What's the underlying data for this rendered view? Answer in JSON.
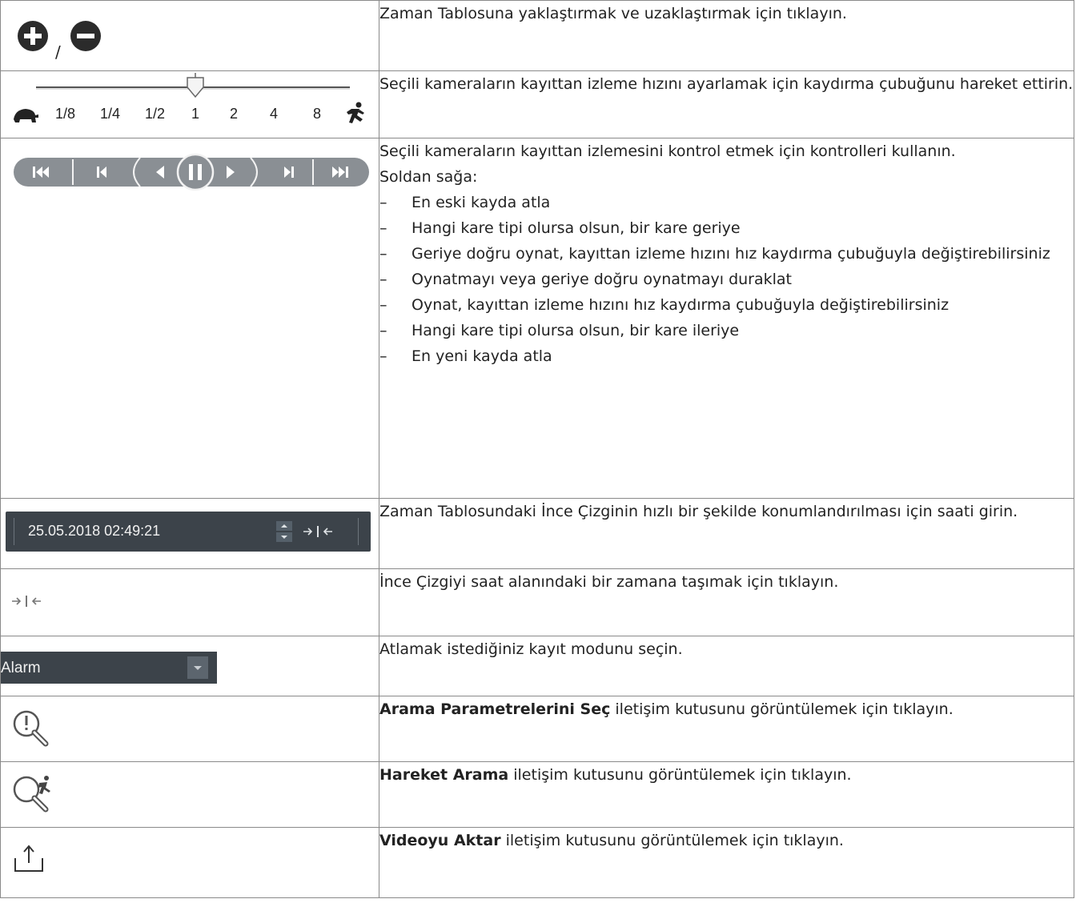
{
  "rows": [
    {
      "icon": "zoom-in-zoom-out-icons",
      "separator": "/",
      "text": "Zaman Tablosuna yaklaştırmak ve uzaklaştırmak için tıklayın."
    },
    {
      "icon": "speed-slider",
      "speed_labels": [
        "1/8",
        "1/4",
        "1/2",
        "1",
        "2",
        "4",
        "8"
      ],
      "speed_value": "1",
      "text": "Seçili kameraların kayıttan izleme hızını ayarlamak için kaydırma çubuğunu hareket ettirin."
    },
    {
      "icon": "playback-controls",
      "intro": "Seçili kameraların kayıttan izlemesini kontrol etmek için kontrolleri kullanın.",
      "order_label": "Soldan sağa:",
      "dash": "–",
      "items": [
        "En eski kayda atla",
        "Hangi kare tipi olursa olsun, bir kare geriye",
        "Geriye doğru oynat, kayıttan izleme hızını hız kaydırma çubuğuyla değiştirebilirsiniz",
        "Oynatmayı veya geriye doğru oynatmayı duraklat",
        "Oynat, kayıttan izleme hızını hız kaydırma çubuğuyla değiştirebilirsiniz",
        "Hangi kare tipi olursa olsun, bir kare ileriye",
        "En yeni kayda atla"
      ]
    },
    {
      "icon": "time-field",
      "time_value": "25.05.2018 02:49:21",
      "text": "Zaman Tablosundaki İnce Çizginin hızlı bir şekilde konumlandırılması için saati girin."
    },
    {
      "icon": "move-hairline-icon",
      "text": "İnce Çizgiyi saat alanındaki bir zamana taşımak için tıklayın."
    },
    {
      "icon": "recording-mode-dropdown",
      "dropdown_value": "Alarm",
      "text": "Atlamak istediğiniz kayıt modunu seçin."
    },
    {
      "icon": "search-parameters-icon",
      "bold": "Arama Parametrelerini Seç",
      "text": " iletişim kutusunu görüntülemek için tıklayın."
    },
    {
      "icon": "motion-search-icon",
      "bold": "Hareket Arama",
      "text": " iletişim kutusunu görüntülemek için tıklayın."
    },
    {
      "icon": "export-video-icon",
      "bold": "Videoyu Aktar",
      "text": " iletişim kutusunu görüntülemek için tıklayın."
    }
  ]
}
